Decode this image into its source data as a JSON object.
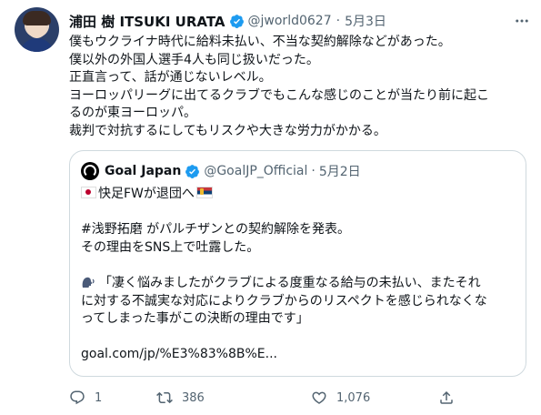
{
  "author": {
    "name": "浦田 樹 ITSUKI URATA",
    "handle": "@jworld0627",
    "separator": "·",
    "date": "5月3日"
  },
  "tweet_lines": [
    "僕もウクライナ時代に給料未払い、不当な契約解除などがあった。",
    "僕以外の外国人選手4人も同じ扱いだった。",
    "正直言って、話が通じないレベル。",
    "ヨーロッパリーグに出てるクラブでもこんな感じのことが当たり前に起こ",
    "るのが東ヨーロッパ。",
    "裁判で対抗するにしてもリスクや大きな労力がかかる。"
  ],
  "quote": {
    "name": "Goal Japan",
    "handle": "@GoalJP_Official",
    "separator": "·",
    "date": "5月2日",
    "line1": "快足FWが退団へ",
    "line2": "#浅野拓磨 がパルチザンとの契約解除を発表。",
    "line3": "その理由をSNS上で吐露した。",
    "line4": "「凄く悩みましたがクラブによる度重なる給与の未払い、またそれ",
    "line5": "に対する不誠実な対応によりクラブからのリスペクトを感じられなくな",
    "line6": "ってしまった事がこの決断の理由です」",
    "url": "goal.com/jp/%E3%83%8B%E..."
  },
  "actions": {
    "reply_count": "1",
    "retweet_count": "386",
    "like_count": "1,076"
  },
  "colors": {
    "text": "#0f1419",
    "secondary": "#536471",
    "verified": "#1d9bf0",
    "border": "#cfd9de"
  },
  "icons": [
    "verified-badge-icon",
    "more-icon",
    "reply-icon",
    "retweet-icon",
    "like-icon",
    "share-icon",
    "japan-flag-icon",
    "serbia-flag-icon",
    "speaking-head-icon"
  ]
}
